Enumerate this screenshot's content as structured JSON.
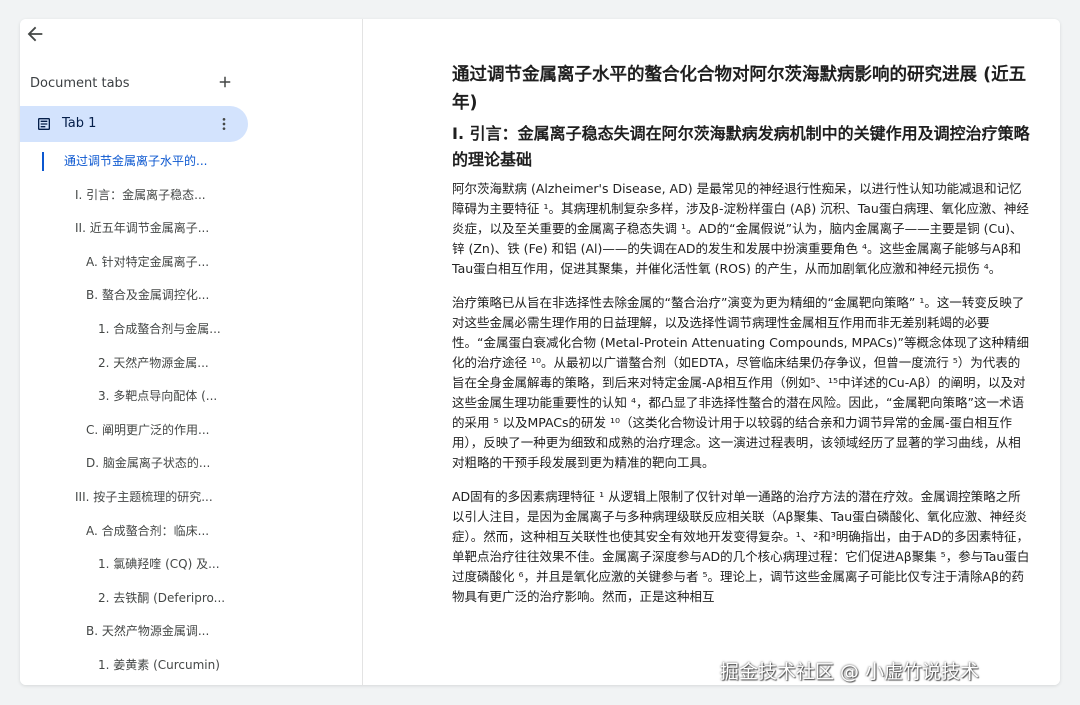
{
  "sidebar": {
    "header": "Document tabs",
    "tab": {
      "label": "Tab 1"
    },
    "outline": [
      {
        "label": "通过调节金属离子水平的...",
        "indent": 44,
        "active": true
      },
      {
        "label": "I. 引言：金属离子稳态...",
        "indent": 55
      },
      {
        "label": "II. 近五年调节金属离子...",
        "indent": 55
      },
      {
        "label": "A. 针对特定金属离子...",
        "indent": 66
      },
      {
        "label": "B. 螯合及金属调控化...",
        "indent": 66
      },
      {
        "label": "1. 合成螯合剂与金属...",
        "indent": 78
      },
      {
        "label": "2. 天然产物源金属...",
        "indent": 78
      },
      {
        "label": "3. 多靶点导向配体 (...",
        "indent": 78
      },
      {
        "label": "C. 阐明更广泛的作用...",
        "indent": 66
      },
      {
        "label": "D. 脑金属离子状态的...",
        "indent": 66
      },
      {
        "label": "III. 按子主题梳理的研究...",
        "indent": 55
      },
      {
        "label": "A. 合成螯合剂：临床...",
        "indent": 66
      },
      {
        "label": "1. 氯碘羟喹 (CQ) 及...",
        "indent": 78
      },
      {
        "label": "2. 去铁酮 (Deferipro...",
        "indent": 78
      },
      {
        "label": "B. 天然产物源金属调...",
        "indent": 66
      },
      {
        "label": "1. 姜黄素 (Curcumin)",
        "indent": 78
      }
    ]
  },
  "doc": {
    "title": "通过调节金属离子水平的螯合化合物对阿尔茨海默病影响的研究进展 (近五年)",
    "h1": "I. 引言：金属离子稳态失调在阿尔茨海默病发病机制中的关键作用及调控治疗策略的理论基础",
    "paragraphs": [
      "阿尔茨海默病 (Alzheimer's Disease, AD) 是最常见的神经退行性痴呆，以进行性认知功能减退和记忆障碍为主要特征 ¹。其病理机制复杂多样，涉及β-淀粉样蛋白 (Aβ) 沉积、Tau蛋白病理、氧化应激、神经炎症，以及至关重要的金属离子稳态失调 ¹。AD的“金属假说”认为，脑内金属离子——主要是铜 (Cu)、锌 (Zn)、铁 (Fe) 和铝 (Al)——的失调在AD的发生和发展中扮演重要角色 ⁴。这些金属离子能够与Aβ和Tau蛋白相互作用，促进其聚集，并催化活性氧 (ROS) 的产生，从而加剧氧化应激和神经元损伤 ⁴。",
      "治疗策略已从旨在非选择性去除金属的“螯合治疗”演变为更为精细的“金属靶向策略” ¹。这一转变反映了对这些金属必需生理作用的日益理解，以及选择性调节病理性金属相互作用而非无差别耗竭的必要性。“金属蛋白衰减化合物 (Metal-Protein Attenuating Compounds, MPACs)”等概念体现了这种精细化的治疗途径 ¹⁰。从最初以广谱螯合剂（如EDTA，尽管临床结果仍存争议，但曾一度流行 ⁵）为代表的旨在全身金属解毒的策略，到后来对特定金属-Aβ相互作用（例如⁵、¹⁵中详述的Cu-Aβ）的阐明，以及对这些金属生理功能重要性的认知 ⁴，都凸显了非选择性螯合的潜在风险。因此，“金属靶向策略”这一术语的采用 ⁵ 以及MPACs的研发 ¹⁰（这类化合物设计用于以较弱的结合亲和力调节异常的金属-蛋白相互作用），反映了一种更为细致和成熟的治疗理念。这一演进过程表明，该领域经历了显著的学习曲线，从相对粗略的干预手段发展到更为精准的靶向工具。",
      "AD固有的多因素病理特征 ¹ 从逻辑上限制了仅针对单一通路的治疗方法的潜在疗效。金属调控策略之所以引人注目，是因为金属离子与多种病理级联反应相关联（Aβ聚集、Tau蛋白磷酸化、氧化应激、神经炎症）。然而，这种相互关联性也使其安全有效地开发变得复杂。¹、²和³明确指出，由于AD的多因素特征，单靶点治疗往往效果不佳。金属离子深度参与AD的几个核心病理过程：它们促进Aβ聚集 ⁵，参与Tau蛋白过度磷酸化 ⁶，并且是氧化应激的关键参与者 ⁵。理论上，调节这些金属离子可能比仅专注于清除Aβ的药物具有更广泛的治疗影响。然而，正是这种相互"
    ]
  },
  "watermark": "掘金技术社区 @ 小虚竹说技术",
  "colors": {
    "accent": "#0b57d0",
    "tab_bg": "#d3e3fd",
    "text": "#1f1f1f"
  }
}
